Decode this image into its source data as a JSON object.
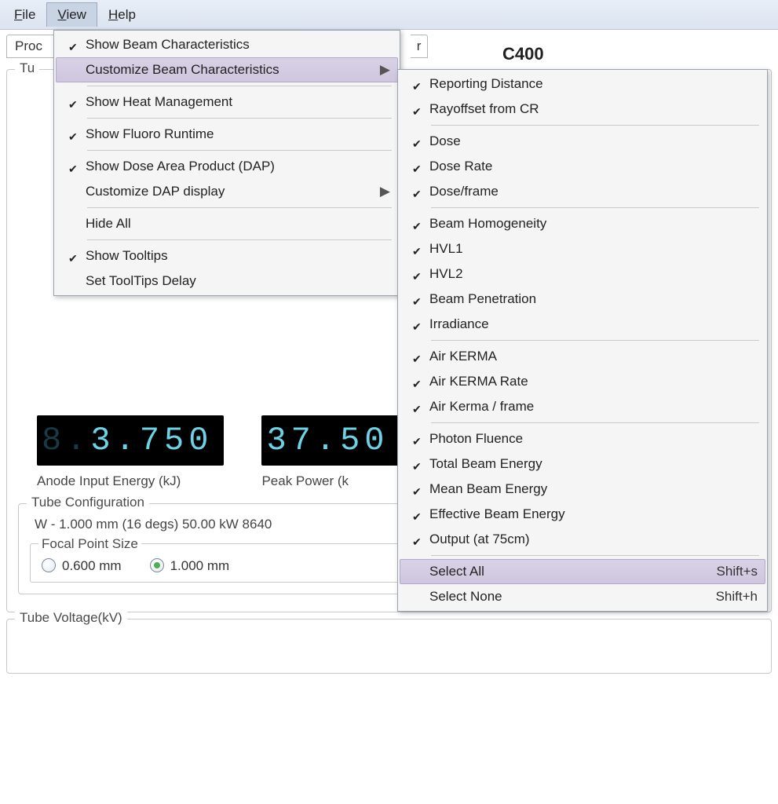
{
  "menubar": {
    "file": "File",
    "view": "View",
    "help": "Help"
  },
  "tabs": {
    "left_partial": "Proc",
    "right_partial": "r"
  },
  "hidden_header": "C400",
  "view_menu": {
    "show_beam": "Show Beam Characteristics",
    "customize_beam": "Customize Beam Characteristics",
    "show_heat": "Show Heat Management",
    "show_fluoro": "Show Fluoro Runtime",
    "show_dap": "Show Dose Area Product (DAP)",
    "customize_dap": "Customize DAP display",
    "hide_all": "Hide All",
    "show_tooltips": "Show Tooltips",
    "set_tooltip_delay": "Set ToolTips Delay"
  },
  "beam_submenu": {
    "reporting_distance": "Reporting Distance",
    "rayoffset": "Rayoffset from CR",
    "dose": "Dose",
    "dose_rate": "Dose Rate",
    "dose_frame": "Dose/frame",
    "beam_homogeneity": "Beam Homogeneity",
    "hvl1": "HVL1",
    "hvl2": "HVL2",
    "beam_penetration": "Beam Penetration",
    "irradiance": "Irradiance",
    "air_kerma": "Air KERMA",
    "air_kerma_rate": "Air KERMA Rate",
    "air_kerma_frame": "Air Kerma / frame",
    "photon_fluence": "Photon Fluence",
    "total_beam_energy": "Total Beam Energy",
    "mean_beam_energy": "Mean Beam Energy",
    "effective_beam_energy": "Effective Beam Energy",
    "output_75": "Output (at 75cm)",
    "select_all": "Select All",
    "select_all_sc": "Shift+s",
    "select_none": "Select None",
    "select_none_sc": "Shift+h"
  },
  "tube_group": {
    "legend_partial": "Tu"
  },
  "gauges": {
    "anode_energy_value": "3.750",
    "anode_energy_label": "Anode Input Energy (kJ)",
    "peak_power_value": "37.50",
    "peak_power_label": "Peak Power (k"
  },
  "tube_config": {
    "legend": "Tube Configuration",
    "line": "W -  1.000 mm (16 degs)  50.00 kW 8640",
    "focal_legend": "Focal Point Size",
    "fp_opt1": "0.600 mm",
    "fp_opt2": "1.000 mm"
  },
  "tube_voltage_legend": "Tube Voltage(kV)"
}
